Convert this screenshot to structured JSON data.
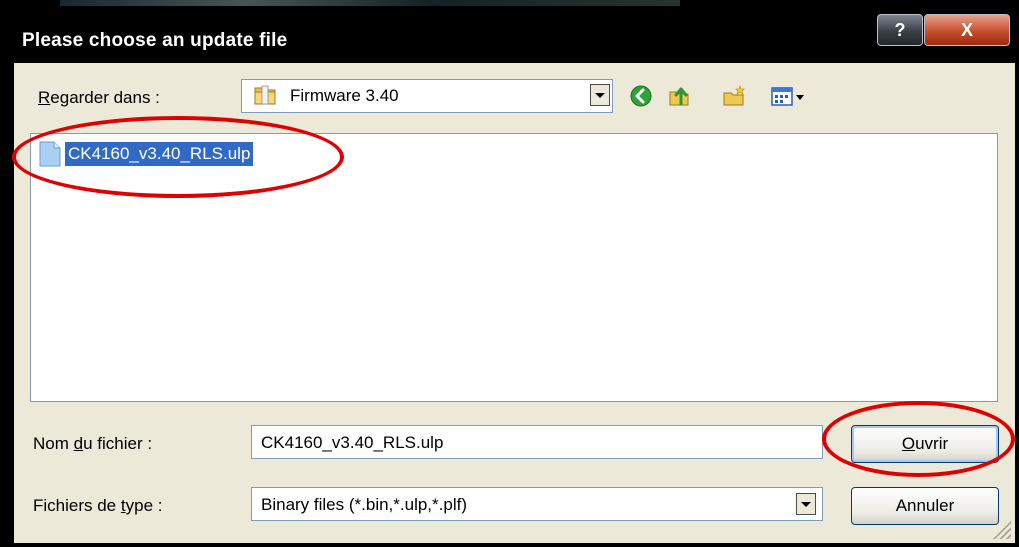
{
  "window": {
    "title": "Please choose an update file",
    "help_label": "?",
    "close_label": "X"
  },
  "lookin": {
    "label_prefix": "",
    "label_mnemonic": "R",
    "label_rest": "egarder dans :",
    "value": "Firmware 3.40",
    "icon": "folder-icon"
  },
  "toolbar": {
    "icons": [
      "back-icon",
      "up-folder-icon",
      "new-folder-icon",
      "view-menu-icon"
    ]
  },
  "file_list": {
    "items": [
      {
        "name": "CK4160_v3.40_RLS.ulp",
        "selected": true,
        "icon": "file-icon"
      }
    ]
  },
  "filename": {
    "label_prefix": "Nom ",
    "label_mnemonic": "d",
    "label_rest": "u fichier :",
    "value": "CK4160_v3.40_RLS.ulp"
  },
  "filetype": {
    "label_prefix": "Fichiers de ",
    "label_mnemonic": "t",
    "label_rest": "ype :",
    "value": "Binary files (*.bin,*.ulp,*.plf)"
  },
  "buttons": {
    "open_mnemonic": "O",
    "open_rest": "uvrir",
    "cancel": "Annuler"
  },
  "colors": {
    "annotation": "#e00000",
    "selection": "#316ac5",
    "dialog_face": "#ece9d8"
  }
}
